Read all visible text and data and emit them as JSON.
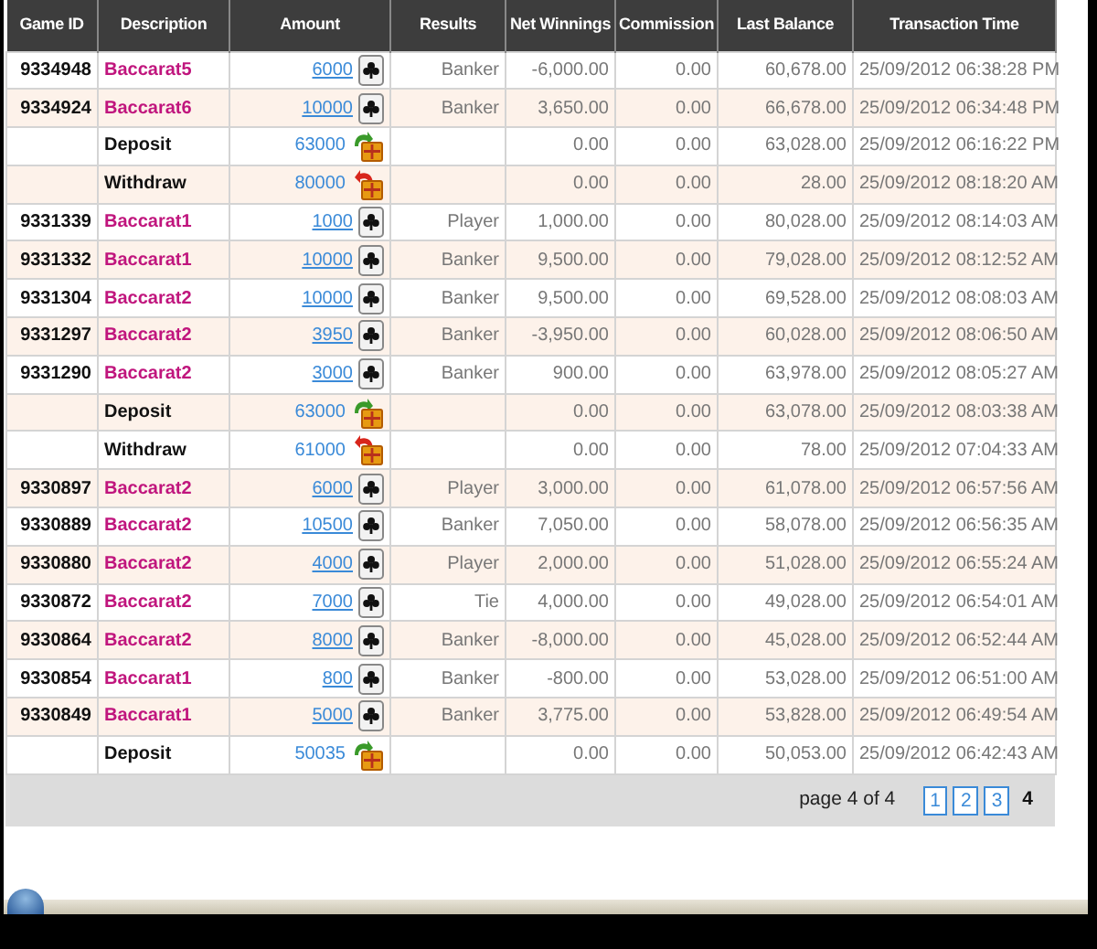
{
  "table": {
    "columns": [
      "Game ID",
      "Description",
      "Amount",
      "Results",
      "Net Winnings",
      "Commission",
      "Last Balance",
      "Transaction Time"
    ],
    "rows": [
      {
        "kind": "bet",
        "game_id": "9334948",
        "description": "Baccarat5",
        "amount": "6000",
        "result": "Banker",
        "net_winnings": "-6,000.00",
        "commission": "0.00",
        "last_balance": "60,678.00",
        "time": "25/09/2012 06:38:28 PM"
      },
      {
        "kind": "bet",
        "game_id": "9334924",
        "description": "Baccarat6",
        "amount": "10000",
        "result": "Banker",
        "net_winnings": "3,650.00",
        "commission": "0.00",
        "last_balance": "66,678.00",
        "time": "25/09/2012 06:34:48 PM"
      },
      {
        "kind": "deposit",
        "description": "Deposit",
        "amount": "63000",
        "net_winnings": "0.00",
        "commission": "0.00",
        "last_balance": "63,028.00",
        "time": "25/09/2012 06:16:22 PM"
      },
      {
        "kind": "withdraw",
        "description": "Withdraw",
        "amount": "80000",
        "net_winnings": "0.00",
        "commission": "0.00",
        "last_balance": "28.00",
        "time": "25/09/2012 08:18:20 AM"
      },
      {
        "kind": "bet",
        "game_id": "9331339",
        "description": "Baccarat1",
        "amount": "1000",
        "result": "Player",
        "net_winnings": "1,000.00",
        "commission": "0.00",
        "last_balance": "80,028.00",
        "time": "25/09/2012 08:14:03 AM"
      },
      {
        "kind": "bet",
        "game_id": "9331332",
        "description": "Baccarat1",
        "amount": "10000",
        "result": "Banker",
        "net_winnings": "9,500.00",
        "commission": "0.00",
        "last_balance": "79,028.00",
        "time": "25/09/2012 08:12:52 AM"
      },
      {
        "kind": "bet",
        "game_id": "9331304",
        "description": "Baccarat2",
        "amount": "10000",
        "result": "Banker",
        "net_winnings": "9,500.00",
        "commission": "0.00",
        "last_balance": "69,528.00",
        "time": "25/09/2012 08:08:03 AM"
      },
      {
        "kind": "bet",
        "game_id": "9331297",
        "description": "Baccarat2",
        "amount": "3950",
        "result": "Banker",
        "net_winnings": "-3,950.00",
        "commission": "0.00",
        "last_balance": "60,028.00",
        "time": "25/09/2012 08:06:50 AM"
      },
      {
        "kind": "bet",
        "game_id": "9331290",
        "description": "Baccarat2",
        "amount": "3000",
        "result": "Banker",
        "net_winnings": "900.00",
        "commission": "0.00",
        "last_balance": "63,978.00",
        "time": "25/09/2012 08:05:27 AM"
      },
      {
        "kind": "deposit",
        "description": "Deposit",
        "amount": "63000",
        "net_winnings": "0.00",
        "commission": "0.00",
        "last_balance": "63,078.00",
        "time": "25/09/2012 08:03:38 AM"
      },
      {
        "kind": "withdraw",
        "description": "Withdraw",
        "amount": "61000",
        "net_winnings": "0.00",
        "commission": "0.00",
        "last_balance": "78.00",
        "time": "25/09/2012 07:04:33 AM"
      },
      {
        "kind": "bet",
        "game_id": "9330897",
        "description": "Baccarat2",
        "amount": "6000",
        "result": "Player",
        "net_winnings": "3,000.00",
        "commission": "0.00",
        "last_balance": "61,078.00",
        "time": "25/09/2012 06:57:56 AM"
      },
      {
        "kind": "bet",
        "game_id": "9330889",
        "description": "Baccarat2",
        "amount": "10500",
        "result": "Banker",
        "net_winnings": "7,050.00",
        "commission": "0.00",
        "last_balance": "58,078.00",
        "time": "25/09/2012 06:56:35 AM"
      },
      {
        "kind": "bet",
        "game_id": "9330880",
        "description": "Baccarat2",
        "amount": "4000",
        "result": "Player",
        "net_winnings": "2,000.00",
        "commission": "0.00",
        "last_balance": "51,028.00",
        "time": "25/09/2012 06:55:24 AM"
      },
      {
        "kind": "bet",
        "game_id": "9330872",
        "description": "Baccarat2",
        "amount": "7000",
        "result": "Tie",
        "net_winnings": "4,000.00",
        "commission": "0.00",
        "last_balance": "49,028.00",
        "time": "25/09/2012 06:54:01 AM"
      },
      {
        "kind": "bet",
        "game_id": "9330864",
        "description": "Baccarat2",
        "amount": "8000",
        "result": "Banker",
        "net_winnings": "-8,000.00",
        "commission": "0.00",
        "last_balance": "45,028.00",
        "time": "25/09/2012 06:52:44 AM"
      },
      {
        "kind": "bet",
        "game_id": "9330854",
        "description": "Baccarat1",
        "amount": "800",
        "result": "Banker",
        "net_winnings": "-800.00",
        "commission": "0.00",
        "last_balance": "53,028.00",
        "time": "25/09/2012 06:51:00 AM"
      },
      {
        "kind": "bet",
        "game_id": "9330849",
        "description": "Baccarat1",
        "amount": "5000",
        "result": "Banker",
        "net_winnings": "3,775.00",
        "commission": "0.00",
        "last_balance": "53,828.00",
        "time": "25/09/2012 06:49:54 AM"
      },
      {
        "kind": "deposit",
        "description": "Deposit",
        "amount": "50035",
        "net_winnings": "0.00",
        "commission": "0.00",
        "last_balance": "50,053.00",
        "time": "25/09/2012 06:42:43 AM"
      }
    ]
  },
  "pagination": {
    "label": "page 4 of 4",
    "pages": [
      {
        "label": "1",
        "selected": false
      },
      {
        "label": "2",
        "selected": false
      },
      {
        "label": "3",
        "selected": false
      },
      {
        "label": "4",
        "selected": true
      }
    ]
  }
}
